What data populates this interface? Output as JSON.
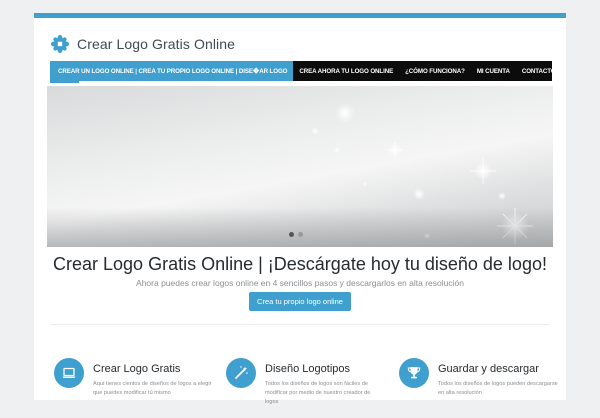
{
  "site": {
    "logo_text": "Crear Logo Gratis Online"
  },
  "nav": {
    "items": [
      {
        "label": "Crear un logo online | Crea tu propio logo online | Dise�ar logo"
      },
      {
        "label": "Crea ahora tu logo online"
      },
      {
        "label": "¿Cómo funciona?"
      },
      {
        "label": "Mi cuenta"
      },
      {
        "label": "Contacto"
      }
    ]
  },
  "hero": {
    "title": "Crear Logo Gratis Online | ¡Descárgate hoy tu diseño de logo!",
    "subtitle": "Ahora puedes crear logos online en 4 sencillos pasos y descargarlos en alta resolución",
    "cta_label": "Crea tu propio logo online"
  },
  "features": [
    {
      "title": "Crear Logo Gratis",
      "description": "Aquí tienes cientos de diseños de logos a elegir que puedes modificar tú mismo",
      "icon": "laptop-icon"
    },
    {
      "title": "Diseño Logotipos",
      "description": "Todos los diseños de logos son fáciles de modificar por medio de nuestro creador de logos",
      "icon": "magic-wand-icon"
    },
    {
      "title": "Guardar y descargar",
      "description": "Todos los diseños de logos pueden descargarse en alta resolución",
      "icon": "trophy-icon"
    }
  ],
  "colors": {
    "accent": "#3f9fce",
    "nav_bg": "#0c0c0c",
    "heading": "#262b2f",
    "muted": "#8a8f93"
  }
}
